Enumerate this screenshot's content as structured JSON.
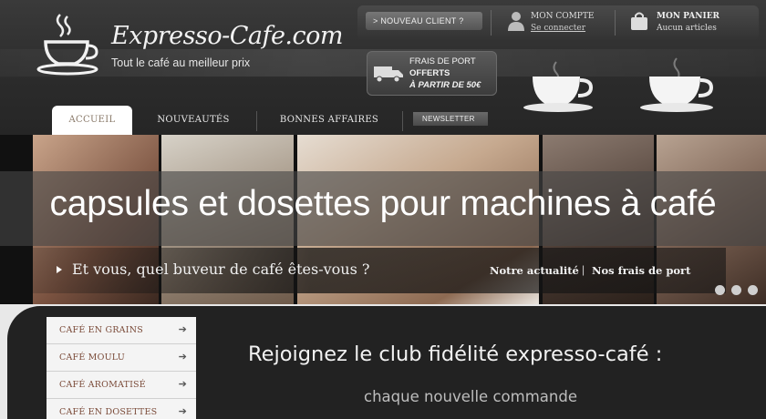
{
  "header": {
    "logo_name": "Expresso-Cafe.com",
    "logo_tagline": "Tout le café au meilleur prix",
    "new_client_label": "> NOUVEAU CLIENT ?",
    "account_title": "MON COMPTE",
    "account_link": "Se connecter",
    "basket_title": "MON PANIER",
    "basket_status": "Aucun articles",
    "shipping_line1": "FRAIS DE PORT",
    "shipping_line2": "OFFERTS",
    "shipping_line3": "À PARTIR DE 50€"
  },
  "nav": {
    "tabs": [
      {
        "label": "ACCUEIL",
        "active": true
      },
      {
        "label": "NOUVEAUTÉS",
        "active": false
      },
      {
        "label": "BONNES AFFAIRES",
        "active": false
      }
    ],
    "newsletter_label": "NEWSLETTER"
  },
  "banner": {
    "overlay_title": "capsules et dosettes pour machines à café",
    "caption": "Et vous, quel buveur de café êtes-vous ?",
    "link_news": "Notre actualité",
    "link_separator": "|",
    "link_shipping": "Nos frais de port",
    "slide_count": 3
  },
  "categories": [
    {
      "label": "CAFÉ EN GRAINS"
    },
    {
      "label": "CAFÉ MOULU"
    },
    {
      "label": "CAFÉ AROMATISÉ"
    },
    {
      "label": "CAFÉ EN DOSETTES"
    }
  ],
  "promo": {
    "title": "Rejoignez le club fidélité expresso-café :",
    "subtitle": "chaque nouvelle commande"
  },
  "icons": {
    "logo": "coffee-cup-icon",
    "account": "user-icon",
    "basket": "shopping-bag-icon",
    "shipping": "truck-icon",
    "category_chevron": "chevron-right-icon"
  },
  "colors": {
    "header_bg": "#2b2b2b",
    "active_tab_text": "#8a7a6a",
    "category_text": "#7a4a38",
    "panel_bg": "#222222"
  }
}
